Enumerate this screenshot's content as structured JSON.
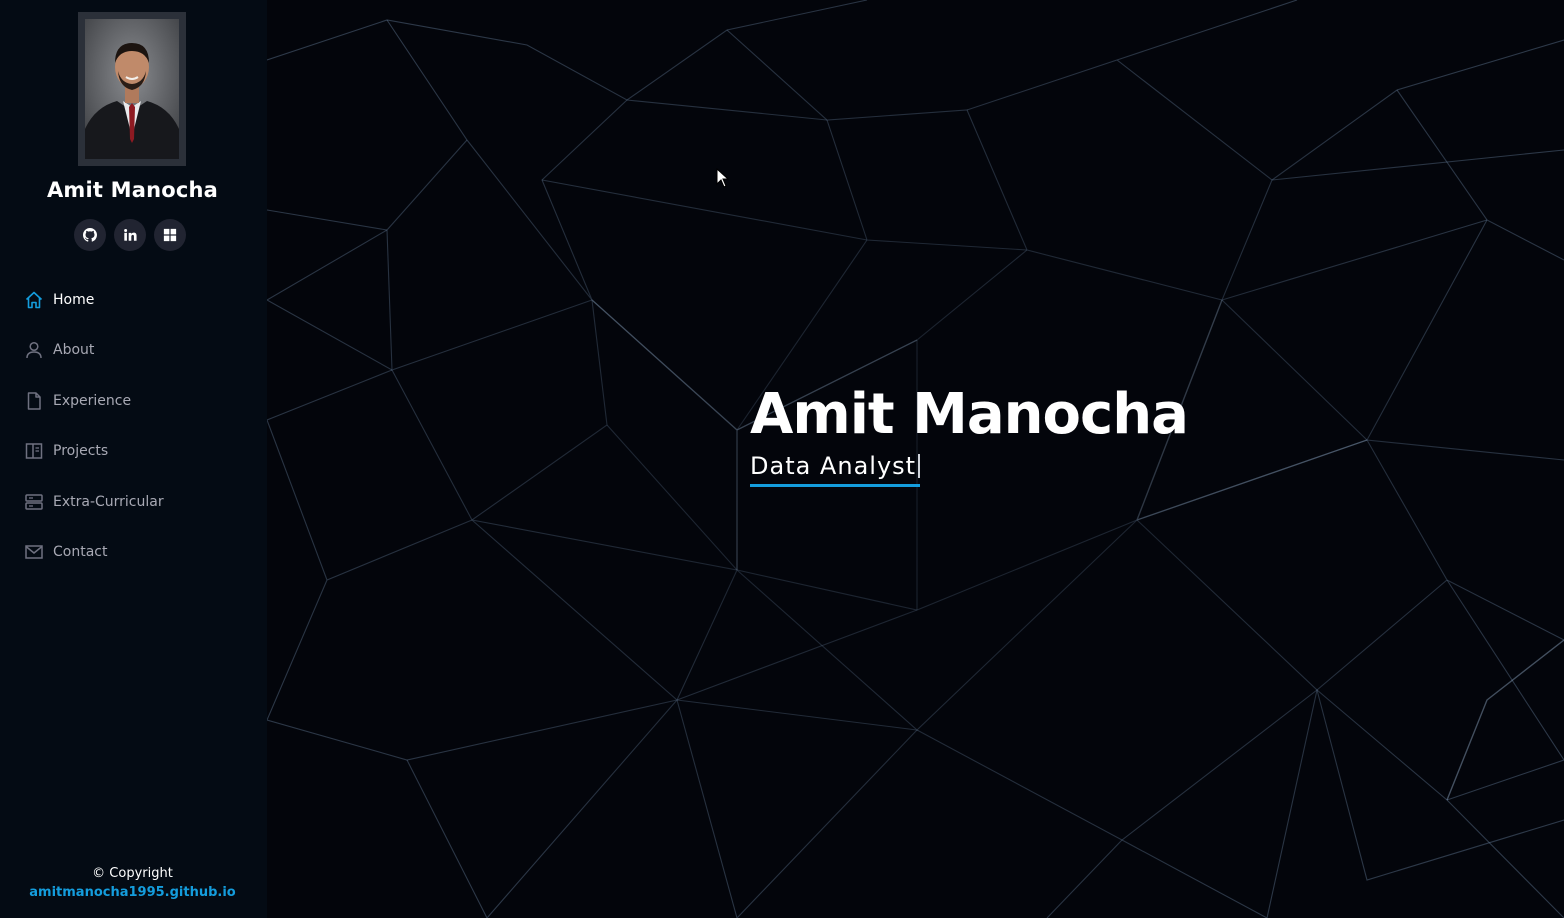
{
  "profile": {
    "name": "Amit Manocha"
  },
  "social": [
    {
      "icon": "github-icon"
    },
    {
      "icon": "linkedin-icon"
    },
    {
      "icon": "grid-icon"
    }
  ],
  "nav": [
    {
      "label": "Home",
      "icon": "home-icon",
      "active": true
    },
    {
      "label": "About",
      "icon": "user-icon"
    },
    {
      "label": "Experience",
      "icon": "file-icon"
    },
    {
      "label": "Projects",
      "icon": "book-icon"
    },
    {
      "label": "Extra-Curricular",
      "icon": "server-icon"
    },
    {
      "label": "Contact",
      "icon": "envelope-icon"
    }
  ],
  "footer": {
    "copyright": "© Copyright",
    "site": "amitmanocha1995.github.io"
  },
  "hero": {
    "title": "Amit Manocha",
    "subtitle": "Data Analyst"
  },
  "colors": {
    "accent": "#149ddd",
    "sidebar_bg": "#040b14",
    "hero_bg": "#03050b"
  }
}
